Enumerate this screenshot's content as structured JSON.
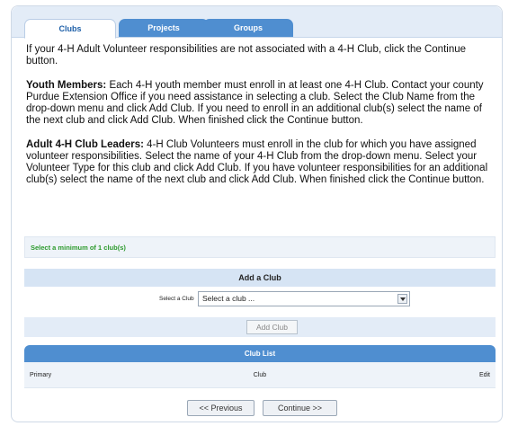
{
  "tabs": [
    {
      "label": "Clubs",
      "active": true
    },
    {
      "label": "Projects",
      "active": false
    },
    {
      "label": "Groups",
      "active": false
    }
  ],
  "intro": "If your 4-H Adult Volunteer responsibilities are not associated with a 4-H Club, click the Continue button.",
  "youth": {
    "heading": "Youth Members:",
    "text": " Each 4-H youth member must enroll in at least one 4-H Club.  Contact your county Purdue Extension Office if you need assistance in selecting a club.  Select the Club Name from the drop-down menu and click Add Club.  If you need to enroll in an additional club(s) select the name of the next club and click Add Club. When finished click the Continue button."
  },
  "adult": {
    "heading": "Adult 4-H Club Leaders:",
    "text": " 4-H Club Volunteers must enroll in the club for which you have assigned volunteer responsibilities. Select the name of your 4-H Club from the drop-down menu. Select your Volunteer Type for this club and click Add Club.  If you have volunteer responsibilities for an additional club(s) select the name of the next club and click Add Club. When finished click the Continue button."
  },
  "notice": "Select a minimum of 1 club(s)",
  "add_club": {
    "header": "Add a Club",
    "select_label": "Select a Club",
    "select_value": "Select a club ...",
    "button": "Add Club"
  },
  "club_list": {
    "header": "Club List",
    "columns": [
      "Primary",
      "Club",
      "Edit"
    ]
  },
  "nav": {
    "previous": "<< Previous",
    "continue": "Continue >>"
  },
  "colors": {
    "tab_blue": "#4f8ed0",
    "notice_green": "#2c9a2c",
    "panel_light": "#e3ecf7"
  }
}
